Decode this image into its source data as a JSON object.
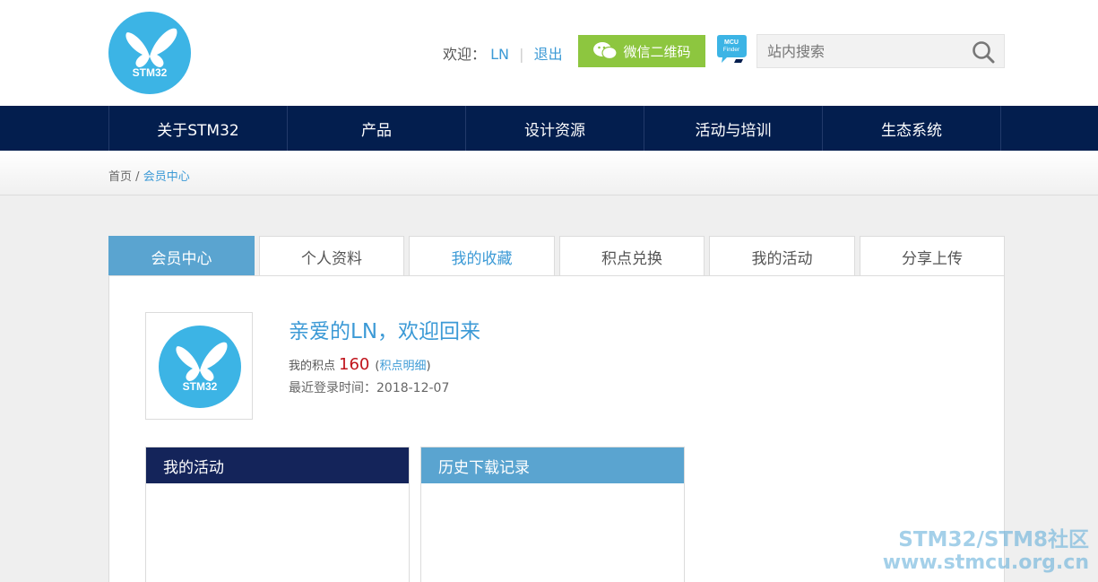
{
  "header": {
    "logo_text": "STM32",
    "welcome_label": "欢迎：",
    "username": "LN",
    "separator": "|",
    "logout": "退出",
    "wechat_button": "微信二维码",
    "mcu_finder_text": "MCU Finder",
    "search_placeholder": "站内搜索"
  },
  "nav": {
    "items": [
      "关于STM32",
      "产品",
      "设计资源",
      "活动与培训",
      "生态系统"
    ]
  },
  "breadcrumb": {
    "home": "首页",
    "divider": "/",
    "current": "会员中心"
  },
  "tabs": [
    "会员中心",
    "个人资料",
    "我的收藏",
    "积点兑换",
    "我的活动",
    "分享上传"
  ],
  "profile": {
    "avatar_text": "STM32",
    "greeting": "亲爱的LN，欢迎回来",
    "points_label": "我的积点",
    "points_value": "160",
    "points_detail_open": "(",
    "points_detail_link": "积点明细",
    "points_detail_close": ")",
    "last_login": "最近登录时间：2018-12-07"
  },
  "panels": {
    "activities_title": "我的活动",
    "downloads_title": "历史下载记录"
  },
  "watermark": {
    "line1": "STM32/STM8社区",
    "line2": "www.stmcu.org.cn"
  },
  "colors": {
    "nav_bg": "#031e4e",
    "accent_blue": "#3c9ad6",
    "tab_active": "#5aa4d0",
    "wechat_green": "#8dc63f",
    "points_red": "#c0141c",
    "logo_blue": "#3cb4e5"
  }
}
